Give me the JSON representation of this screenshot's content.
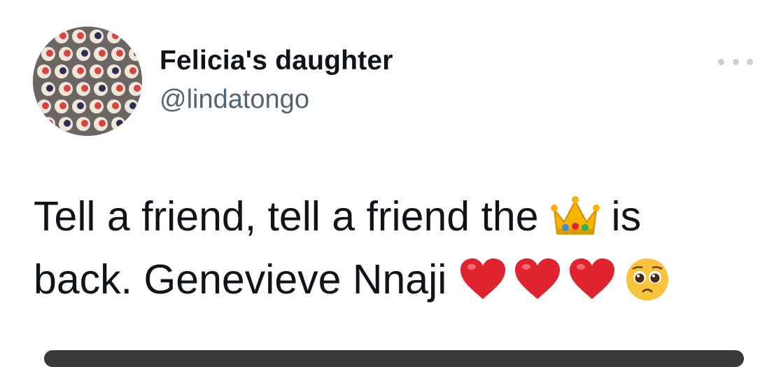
{
  "author": {
    "display_name": "Felicia's daughter",
    "handle": "@lindatongo",
    "avatar_icon": "avatar-photo"
  },
  "more_icon": "more-dots-icon",
  "tweet": {
    "line1_text": "Tell a friend, tell a friend the",
    "line1_emoji": "crown-emoji",
    "line1_end": "is",
    "line2_text": "back. Genevieve Nnaji",
    "line2_emojis": [
      "red-heart-emoji",
      "red-heart-emoji",
      "red-heart-emoji",
      "pleading-face-emoji"
    ]
  },
  "colors": {
    "text": "#0f1419",
    "secondary": "#536471",
    "heart": "#e0242f",
    "crown": "#f5b400"
  }
}
